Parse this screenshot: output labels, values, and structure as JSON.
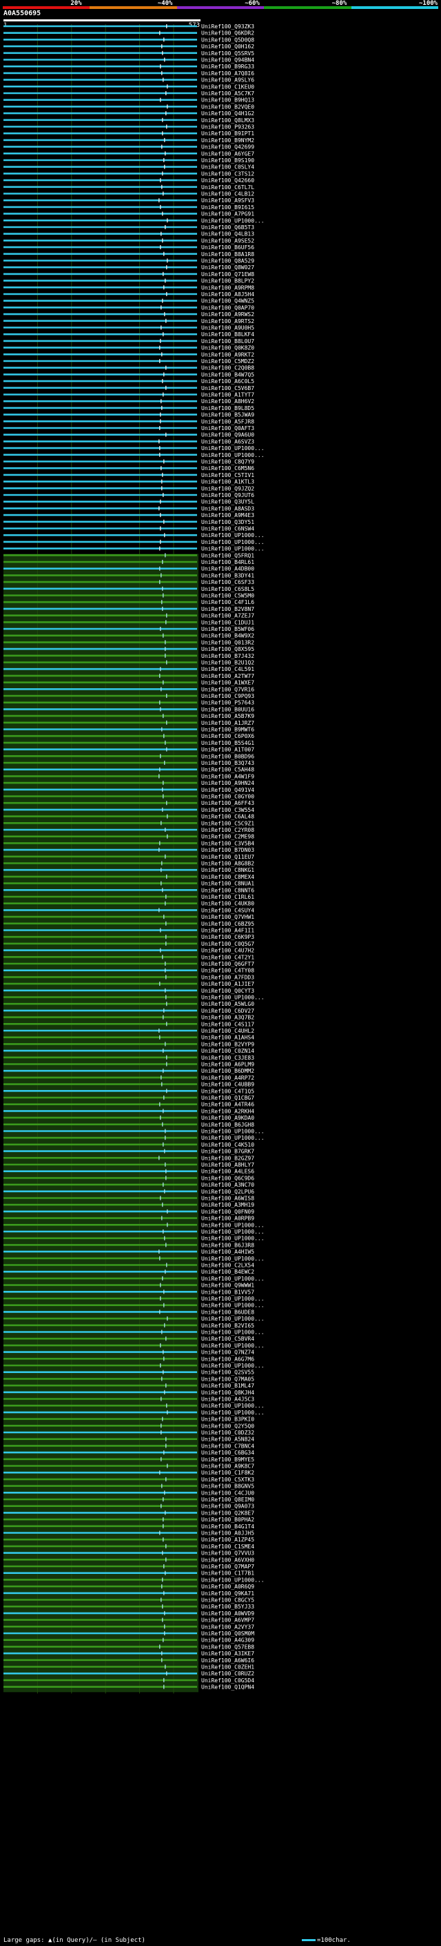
{
  "scale": {
    "labels": [
      "20%",
      "~40%",
      "~60%",
      "~80%",
      "~100%"
    ],
    "colors": [
      "#e01010",
      "#e07a10",
      "#8a28c8",
      "#18a018",
      "#20c8e0"
    ]
  },
  "query": {
    "id": "A0A550695",
    "start": "1",
    "end": "573"
  },
  "colors": {
    "blue": "#33c8e8",
    "green": "#3a9a1c",
    "grid": "#1f4a0a"
  },
  "chart_data": {
    "type": "table",
    "query_length": 573,
    "ids": [
      "UniRef100_Q93ZK3",
      "UniRef100_Q6KDR2",
      "UniRef100_Q5D0Q8",
      "UniRef100_Q0H162",
      "UniRef100_Q5SRV5",
      "UniRef100_Q94BN4",
      "UniRef100_B9RG33",
      "UniRef100_A7Q8I6",
      "UniRef100_A9SLY6",
      "UniRef100_C1KEU0",
      "UniRef100_A5C7K7",
      "UniRef100_B9HQ13",
      "UniRef100_B2VQE0",
      "UniRef100_Q4H1G2",
      "UniRef100_Q8LMX3",
      "UniRef100_P93263",
      "UniRef100_B9IPT1",
      "UniRef100_B9NYM2",
      "UniRef100_Q42699",
      "UniRef100_A6YGE7",
      "UniRef100_B9S190",
      "UniRef100_C0SLY4",
      "UniRef100_C3TS12",
      "UniRef100_Q42660",
      "UniRef100_C6TL7L",
      "UniRef100_C4LB12",
      "UniRef100_A9SFV3",
      "UniRef100_B9I615",
      "UniRef100_A7PG91",
      "UniRef100_UP1000...",
      "UniRef100_Q6B5T3",
      "UniRef100_Q4LB13",
      "UniRef100_A9SE52",
      "UniRef100_B6UF56",
      "UniRef100_B8A1R8",
      "UniRef100_Q8A529",
      "UniRef100_Q8W027",
      "UniRef100_Q71EW8",
      "UniRef100_B8LPY2",
      "UniRef100_A9RPM8",
      "UniRef100_A8J5H4",
      "UniRef100_Q4WNZ5",
      "UniRef100_Q0AP70",
      "UniRef100_A9RWS2",
      "UniRef100_A9RTS2",
      "UniRef100_A9U0H5",
      "UniRef100_B8LKF4",
      "UniRef100_B8L0U7",
      "UniRef100_Q0K8Z0",
      "UniRef100_A9RKT2",
      "UniRef100_C5MDZ2",
      "UniRef100_C2Q0B8",
      "UniRef100_B4W7Q5",
      "UniRef100_A6C0L5",
      "UniRef100_C5V6B7",
      "UniRef100_A1TYT7",
      "UniRef100_A8H6V2",
      "UniRef100_B9L8D5",
      "UniRef100_B5JWA9",
      "UniRef100_A5FJR8",
      "UniRef100_Q0AFT3",
      "UniRef100_Q9A6U0",
      "UniRef100_A6SVZ3",
      "UniRef100_UP1000...",
      "UniRef100_UP1000...",
      "UniRef100_C8Q7Y9",
      "UniRef100_C6M5N6",
      "UniRef100_C5TIV1",
      "UniRef100_A1KTL3",
      "UniRef100_Q9JZQ2",
      "UniRef100_Q9JUT6",
      "UniRef100_Q3UY5L",
      "UniRef100_A8ASD3",
      "UniRef100_A9M4E3",
      "UniRef100_Q3DY51",
      "UniRef100_C6NSW4",
      "UniRef100_UP1000...",
      "UniRef100_UP1000...",
      "UniRef100_UP1000...",
      "UniRef100_Q5FRQ1",
      "UniRef100_B4RL61",
      "UniRef100_A4DB00",
      "UniRef100_B3DY41",
      "UniRef100_C6SF33",
      "UniRef100_C6S8L5",
      "UniRef100_C5W5M0",
      "UniRef100_C4F1L6",
      "UniRef100_B2V8N7",
      "UniRef100_A7ZEJ7",
      "UniRef100_C1DUJ1",
      "UniRef100_B5WF06",
      "UniRef100_B4W9X2",
      "UniRef100_Q013R2",
      "UniRef100_Q8X595",
      "UniRef100_B7J432",
      "UniRef100_B2U1Q2",
      "UniRef100_C4L591",
      "UniRef100_A2TW77",
      "UniRef100_A1WXE7",
      "UniRef100_Q7VR16",
      "UniRef100_C9PQ93",
      "UniRef100_P57643",
      "UniRef100_B0UU16",
      "UniRef100_A5B7K9",
      "UniRef100_A1JRZ7",
      "UniRef100_B9MWT6",
      "UniRef100_C6P0X6",
      "UniRef100_B5S4G1",
      "UniRef100_A1T007",
      "UniRef100_B0BD96",
      "UniRef100_B3Q743",
      "UniRef100_C5AH48",
      "UniRef100_A4W1F9",
      "UniRef100_A9HN24",
      "UniRef100_Q491V4",
      "UniRef100_C0GY00",
      "UniRef100_A6FF43",
      "UniRef100_C3W554",
      "UniRef100_C6AL48",
      "UniRef100_C5C9Z1",
      "UniRef100_C2YR08",
      "UniRef100_C2ME98",
      "UniRef100_C3V5B4",
      "UniRef100_B7DN03",
      "UniRef100_Q11EU7",
      "UniRef100_A8G8B2",
      "UniRef100_C8NKG1",
      "UniRef100_C8MEX4",
      "UniRef100_C8NUA1",
      "UniRef100_C8NNT6",
      "UniRef100_C1RL61",
      "UniRef100_C4UK80",
      "UniRef100_C4SUY4",
      "UniRef100_Q7VHW1",
      "UniRef100_C6BZ95",
      "UniRef100_A4F1I1",
      "UniRef100_C6K9P3",
      "UniRef100_C0Q5G7",
      "UniRef100_C4U7H2",
      "UniRef100_C4T2Y1",
      "UniRef100_Q6GFT7",
      "UniRef100_C4TY08",
      "UniRef100_A7FDD3",
      "UniRef100_A1JIE7",
      "UniRef100_Q0CYT3",
      "UniRef100_UP1000...",
      "UniRef100_A5WLG0",
      "UniRef100_C6DV27",
      "UniRef100_A3Q7B2",
      "UniRef100_C4S117",
      "UniRef100_C4UHL2",
      "UniRef100_A1AHS4",
      "UniRef100_B2VYP9",
      "UniRef100_C0ZN14",
      "UniRef100_C3JE83",
      "UniRef100_A6PLM9",
      "UniRef100_B6DMM2",
      "UniRef100_A4RP72",
      "UniRef100_C4UBB9",
      "UniRef100_C4T1Q5",
      "UniRef100_Q1CBG7",
      "UniRef100_A4TR46",
      "UniRef100_A2RKH4",
      "UniRef100_A9KDA0",
      "UniRef100_B6JGH8",
      "UniRef100_UP1000...",
      "UniRef100_UP1000...",
      "UniRef100_C4K510",
      "UniRef100_B7GRK7",
      "UniRef100_B2GZ97",
      "UniRef100_A8HLY7",
      "UniRef100_A4LES6",
      "UniRef100_Q6C9D6",
      "UniRef100_A3NC70",
      "UniRef100_Q2LPU6",
      "UniRef100_A6WIS8",
      "UniRef100_A3MH19",
      "UniRef100_Q0FN09",
      "UniRef100_A0RPB9",
      "UniRef100_UP1000...",
      "UniRef100_UP1000...",
      "UniRef100_UP1000...",
      "UniRef100_B6J3R8",
      "UniRef100_A4HIW5",
      "UniRef100_UP1000...",
      "UniRef100_C2LX54",
      "UniRef100_B4EWC2",
      "UniRef100_UP1000...",
      "UniRef100_Q9WWW1",
      "UniRef100_B1VV57",
      "UniRef100_UP1000...",
      "UniRef100_UP1000...",
      "UniRef100_B6UDE8",
      "UniRef100_UP1000...",
      "UniRef100_B2VI65",
      "UniRef100_UP1000...",
      "UniRef100_C5BVR4",
      "UniRef100_UP1000...",
      "UniRef100_Q7NZ74",
      "UniRef100_A6G7M6",
      "UniRef100_UP1000...",
      "UniRef100_Q2SV55",
      "UniRef100_Q7MA05",
      "UniRef100_B1ML47",
      "UniRef100_Q8KJH4",
      "UniRef100_A4J5C3",
      "UniRef100_UP1000...",
      "UniRef100_UP1000...",
      "UniRef100_B3PKI0",
      "UniRef100_Q2Y5Q0",
      "UniRef100_C0DZ32",
      "UniRef100_A5N824",
      "UniRef100_C7BNC4",
      "UniRef100_C6BG34",
      "UniRef100_B9MYE5",
      "UniRef100_A9K8C7",
      "UniRef100_C1F8K2",
      "UniRef100_C5XTK3",
      "UniRef100_B8GNV5",
      "UniRef100_C4CJU0",
      "UniRef100_Q8EIM0",
      "UniRef100_Q9A073",
      "UniRef100_Q2K8E7",
      "UniRef100_B0PHA2",
      "UniRef100_B4G1T4",
      "UniRef100_A0JJH5",
      "UniRef100_A1ZP45",
      "UniRef100_C1SME4",
      "UniRef100_Q7VVU3",
      "UniRef100_A6VXH0",
      "UniRef100_Q7MAP7",
      "UniRef100_C1T7B1",
      "UniRef100_UP1000...",
      "UniRef100_A0R6Q9",
      "UniRef100_Q9KA71",
      "UniRef100_C8GCY5",
      "UniRef100_B5YJ33",
      "UniRef100_A0WVD9",
      "UniRef100_A6VMP7",
      "UniRef100_A2VY37",
      "UniRef100_Q0SM0M",
      "UniRef100_A4G309",
      "UniRef100_Q57EB8",
      "UniRef100_A3IKE7",
      "UniRef100_A6W6I6",
      "UniRef100_C0ZEH1",
      "UniRef100_C0RUZ2",
      "UniRef100_C0G5D4",
      "UniRef100_Q1QPN4"
    ]
  },
  "footer": {
    "text": "Large gaps: ▲(in Query)/— (in Subject)"
  },
  "legend": {
    "text": "=100char."
  }
}
